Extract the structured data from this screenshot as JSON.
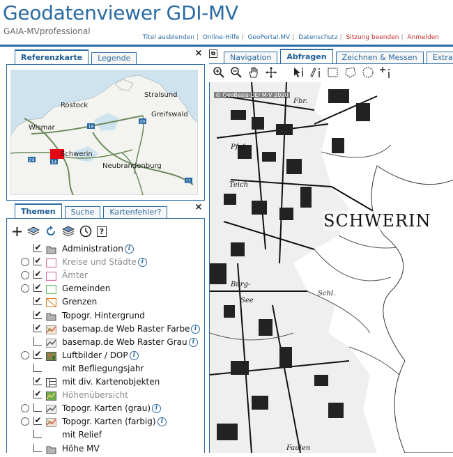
{
  "header": {
    "title": "Geodatenviewer GDI-MV",
    "subtitle": "GAIA-MVprofessional",
    "links": [
      {
        "label": "Titel ausblenden",
        "color": "#2a6aa3"
      },
      {
        "label": "Online-Hilfe",
        "color": "#2a6aa3"
      },
      {
        "label": "GeoPortal.MV",
        "color": "#2a6aa3"
      },
      {
        "label": "Datenschutz",
        "color": "#2a6aa3"
      },
      {
        "label": "Sitzung beenden",
        "color": "#c62828"
      },
      {
        "label": "Anmelden",
        "color": "#c62828"
      }
    ]
  },
  "overview_panel": {
    "tabs": [
      "Referenzkarte",
      "Legende"
    ],
    "active_tab": "Referenzkarte",
    "close_label": "×",
    "map_labels": [
      "Stralsund",
      "Rostock",
      "Greifswald",
      "Wismar",
      "Schwerin",
      "Neubrandenburg"
    ],
    "road_badges": [
      "20",
      "19",
      "24",
      "14",
      "11"
    ]
  },
  "layers_panel": {
    "tabs": [
      "Themen",
      "Suche",
      "Kartenfehler?"
    ],
    "active_tab": "Themen",
    "close_label": "×",
    "toolbar_icons": [
      "add-layer-icon",
      "layers-icon",
      "refresh-icon",
      "layer-stack-icon",
      "clock-icon",
      "help-icon"
    ],
    "help_glyph": "?",
    "layers": [
      {
        "label": "Administration",
        "type": "group",
        "checked": true,
        "radio": false,
        "greyed": false,
        "info": true
      },
      {
        "label": "Kreise und Städte",
        "type": "layer",
        "checked": true,
        "radio": true,
        "greyed": true,
        "info": true
      },
      {
        "label": "Ämter",
        "type": "layer",
        "checked": true,
        "radio": true,
        "greyed": true,
        "info": false
      },
      {
        "label": "Gemeinden",
        "type": "layer",
        "checked": true,
        "radio": true,
        "greyed": false,
        "info": false
      },
      {
        "label": "Grenzen",
        "type": "layer",
        "checked": true,
        "radio": false,
        "greyed": false,
        "info": false
      },
      {
        "label": "Topogr. Hintergrund",
        "type": "group",
        "checked": true,
        "radio": false,
        "greyed": false,
        "info": false
      },
      {
        "label": "basemap.de Web Raster Farbe",
        "type": "layer",
        "checked": true,
        "radio": false,
        "greyed": false,
        "info": true
      },
      {
        "label": "basemap.de Web Raster Grau",
        "type": "layer",
        "checked": false,
        "radio": false,
        "greyed": false,
        "info": true
      },
      {
        "label": "Luftbilder / DOP",
        "type": "layer",
        "checked": true,
        "radio": true,
        "greyed": false,
        "info": true
      },
      {
        "label": "mit Befliegungsjahr",
        "type": "sublayer",
        "checked": false,
        "radio": false,
        "greyed": false,
        "info": false
      },
      {
        "label": "mit div. Kartenobjekten",
        "type": "layer",
        "checked": true,
        "radio": false,
        "greyed": false,
        "info": false
      },
      {
        "label": "Höhenübersicht",
        "type": "layer",
        "checked": true,
        "radio": false,
        "greyed": true,
        "info": false
      },
      {
        "label": "Topogr. Karten (grau)",
        "type": "layer",
        "checked": false,
        "radio": true,
        "greyed": false,
        "info": true
      },
      {
        "label": "Topogr. Karten (farbig)",
        "type": "layer",
        "checked": true,
        "radio": true,
        "greyed": false,
        "info": true
      },
      {
        "label": "mit Relief",
        "type": "sublayer",
        "checked": false,
        "radio": false,
        "greyed": false,
        "info": false
      },
      {
        "label": "Höhe MV",
        "type": "group",
        "checked": false,
        "radio": false,
        "greyed": false,
        "info": false
      }
    ]
  },
  "map_panel": {
    "tabs": [
      "Navigation",
      "Abfragen",
      "Zeichnen & Messen",
      "Extras"
    ],
    "active_tab": "Abfragen",
    "tools": [
      "zoom-in-icon",
      "zoom-out-icon",
      "pan-hand-icon",
      "move-icon",
      "select-info-icon",
      "info-cursor-icon",
      "rectangle-select-icon",
      "polygon-select-icon",
      "circle-select-icon",
      "point-info-icon"
    ],
    "copyright": "© GeoBasis-DE/ M-V 2020",
    "city_label": "SCHWERIN",
    "map_words": [
      "Fbr.",
      "Pfaf",
      "Teich",
      "Burg-",
      "See",
      "Schl.",
      "Faulen"
    ]
  },
  "colors": {
    "accent": "#2a6aa3",
    "danger": "#c62828",
    "grey_text": "#8a8a8a"
  }
}
